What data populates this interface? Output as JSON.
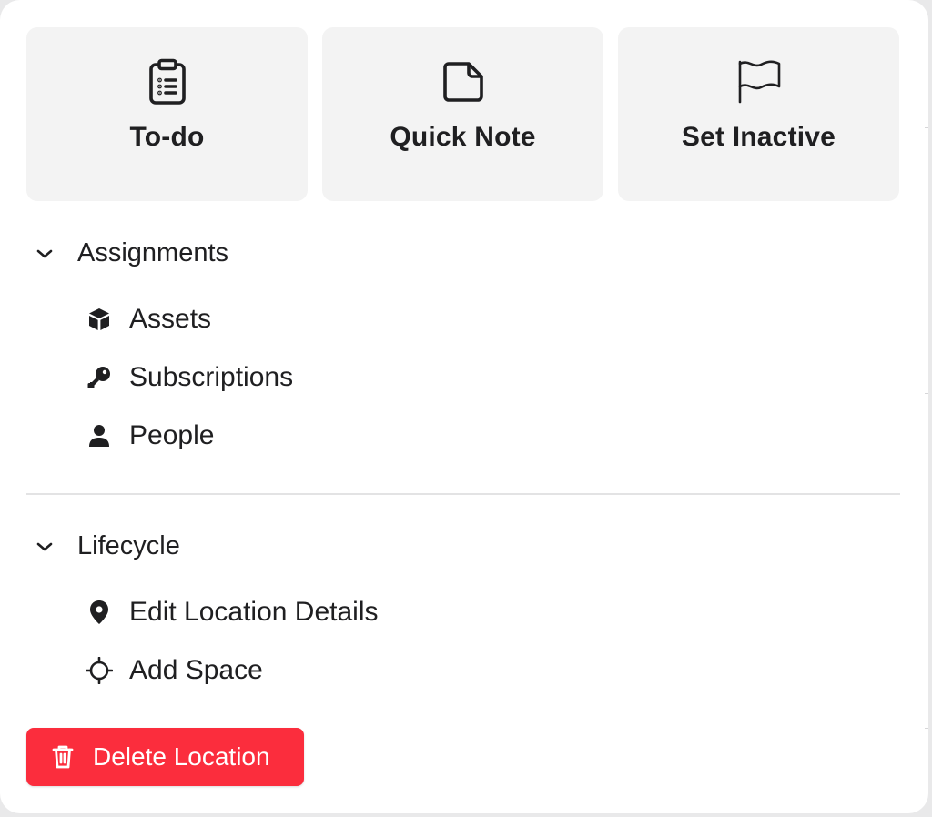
{
  "quick_actions": [
    {
      "label": "To-do",
      "icon": "clipboard-list-icon"
    },
    {
      "label": "Quick Note",
      "icon": "note-icon"
    },
    {
      "label": "Set Inactive",
      "icon": "flag-icon"
    }
  ],
  "assignments": {
    "title": "Assignments",
    "items": [
      {
        "label": "Assets",
        "icon": "cube-icon"
      },
      {
        "label": "Subscriptions",
        "icon": "key-icon"
      },
      {
        "label": "People",
        "icon": "person-icon"
      }
    ]
  },
  "lifecycle": {
    "title": "Lifecycle",
    "items": [
      {
        "label": "Edit Location Details",
        "icon": "map-pin-icon"
      },
      {
        "label": "Add Space",
        "icon": "crosshair-icon"
      }
    ]
  },
  "delete_button": {
    "label": "Delete Location",
    "icon": "trash-icon"
  },
  "colors": {
    "danger": "#fb2d3d",
    "card_bg": "#f3f3f3",
    "text": "#1f1f21"
  }
}
